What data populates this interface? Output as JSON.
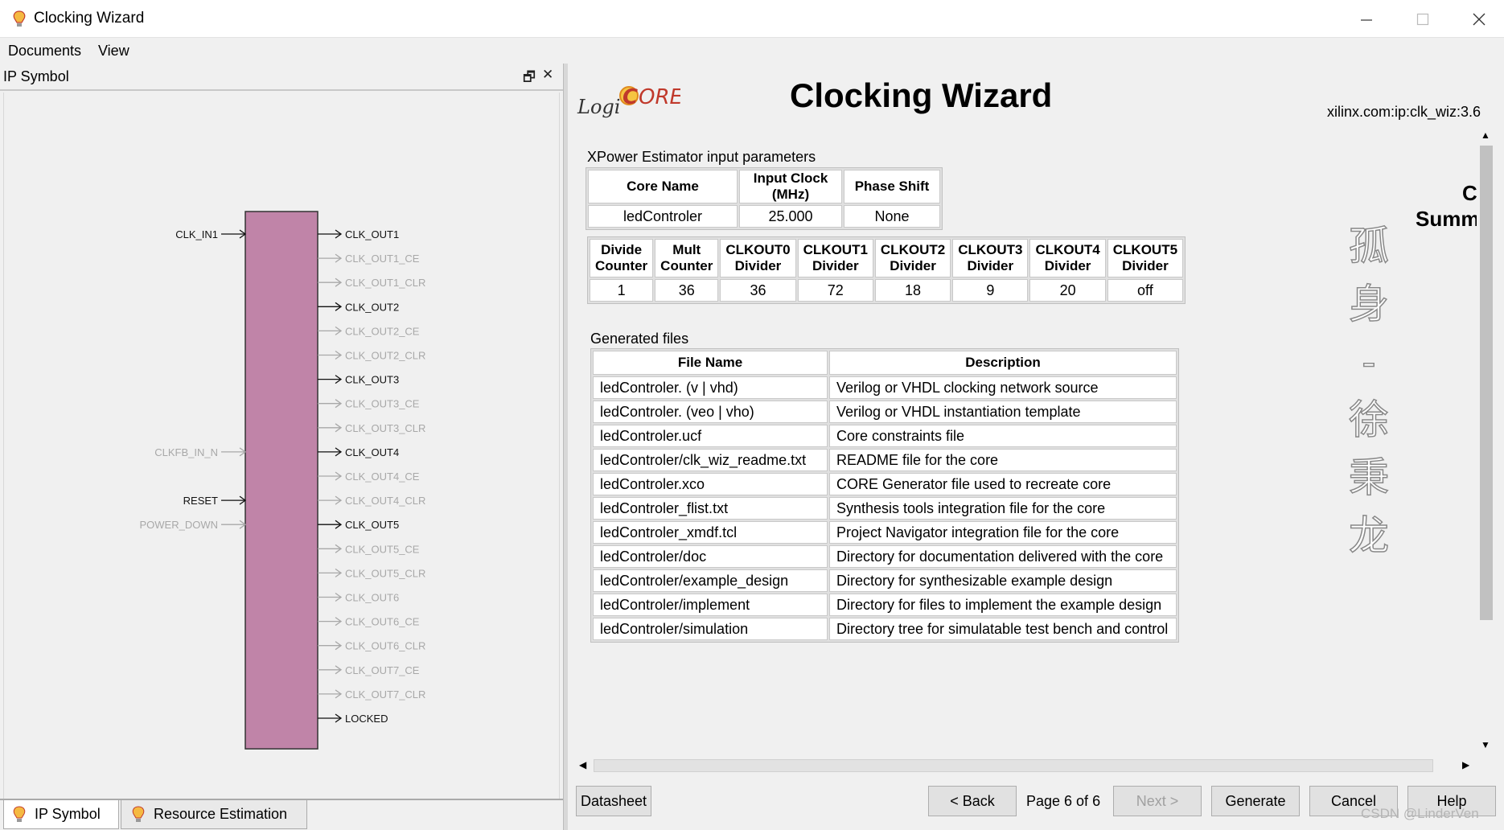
{
  "window": {
    "title": "Clocking Wizard"
  },
  "menu": [
    {
      "label": "Documents"
    },
    {
      "label": "View"
    }
  ],
  "left_panel": {
    "title": "IP Symbol",
    "inputs": [
      {
        "label": "CLK_IN1",
        "active": true
      },
      {
        "label": "CLKFB_IN_N",
        "active": false
      },
      {
        "label": "RESET",
        "active": true
      },
      {
        "label": "POWER_DOWN",
        "active": false
      }
    ],
    "outputs": [
      {
        "label": "CLK_OUT1",
        "active": true
      },
      {
        "label": "CLK_OUT1_CE",
        "active": false
      },
      {
        "label": "CLK_OUT1_CLR",
        "active": false
      },
      {
        "label": "CLK_OUT2",
        "active": true
      },
      {
        "label": "CLK_OUT2_CE",
        "active": false
      },
      {
        "label": "CLK_OUT2_CLR",
        "active": false
      },
      {
        "label": "CLK_OUT3",
        "active": true
      },
      {
        "label": "CLK_OUT3_CE",
        "active": false
      },
      {
        "label": "CLK_OUT3_CLR",
        "active": false
      },
      {
        "label": "CLK_OUT4",
        "active": true
      },
      {
        "label": "CLK_OUT4_CE",
        "active": false
      },
      {
        "label": "CLK_OUT4_CLR",
        "active": false
      },
      {
        "label": "CLK_OUT5",
        "active": true
      },
      {
        "label": "CLK_OUT5_CE",
        "active": false
      },
      {
        "label": "CLK_OUT5_CLR",
        "active": false
      },
      {
        "label": "CLK_OUT6",
        "active": false
      },
      {
        "label": "CLK_OUT6_CE",
        "active": false
      },
      {
        "label": "CLK_OUT6_CLR",
        "active": false
      },
      {
        "label": "CLK_OUT7_CE",
        "active": false
      },
      {
        "label": "CLK_OUT7_CLR",
        "active": false
      },
      {
        "label": "LOCKED",
        "active": true
      }
    ],
    "block_color": "#c084a8",
    "tabs": [
      {
        "label": "IP Symbol",
        "active": true
      },
      {
        "label": "Resource Estimation",
        "active": false
      }
    ]
  },
  "header": {
    "logo": "LogiCORE",
    "title": "Clocking Wizard",
    "ip_name": "xilinx.com:ip:clk_wiz:3.6",
    "side_text": [
      "C",
      "Summ"
    ]
  },
  "xpower": {
    "label": "XPower Estimator input parameters",
    "headers": [
      "Core Name",
      "Input Clock (MHz)",
      "Phase Shift"
    ],
    "row": [
      "ledControler",
      "25.000",
      "None"
    ]
  },
  "dividers": {
    "headers": [
      [
        "Divide",
        "Counter"
      ],
      [
        "Mult",
        "Counter"
      ],
      [
        "CLKOUT0",
        "Divider"
      ],
      [
        "CLKOUT1",
        "Divider"
      ],
      [
        "CLKOUT2",
        "Divider"
      ],
      [
        "CLKOUT3",
        "Divider"
      ],
      [
        "CLKOUT4",
        "Divider"
      ],
      [
        "CLKOUT5",
        "Divider"
      ]
    ],
    "row": [
      "1",
      "36",
      "36",
      "72",
      "18",
      "9",
      "20",
      "off"
    ]
  },
  "files": {
    "label": "Generated files",
    "headers": [
      "File Name",
      "Description"
    ],
    "rows": [
      [
        "ledControler. (v | vhd)",
        "Verilog or VHDL clocking network source"
      ],
      [
        "ledControler. (veo | vho)",
        "Verilog or VHDL instantiation template"
      ],
      [
        "ledControler.ucf",
        "Core constraints file"
      ],
      [
        "ledControler/clk_wiz_readme.txt",
        "README file for the core"
      ],
      [
        "ledControler.xco",
        "CORE Generator file used to recreate core"
      ],
      [
        "ledControler_flist.txt",
        "Synthesis tools integration file for the core"
      ],
      [
        "ledControler_xmdf.tcl",
        "Project Navigator integration file for the core"
      ],
      [
        "ledControler/doc",
        "Directory for documentation delivered with the core"
      ],
      [
        "ledControler/example_design",
        "Directory for synthesizable example design"
      ],
      [
        "ledControler/implement",
        "Directory for files to implement the example design"
      ],
      [
        "ledControler/simulation",
        "Directory tree for simulatable test bench and control"
      ]
    ]
  },
  "vertical_text": [
    "孤",
    "身",
    "-",
    "徐",
    "秉",
    "龙"
  ],
  "buttons": {
    "datasheet": "Datasheet",
    "back": "< Back",
    "page": "Page 6 of 6",
    "next": "Next >",
    "generate": "Generate",
    "cancel": "Cancel",
    "help": "Help"
  },
  "watermark": "CSDN @LinderVen"
}
